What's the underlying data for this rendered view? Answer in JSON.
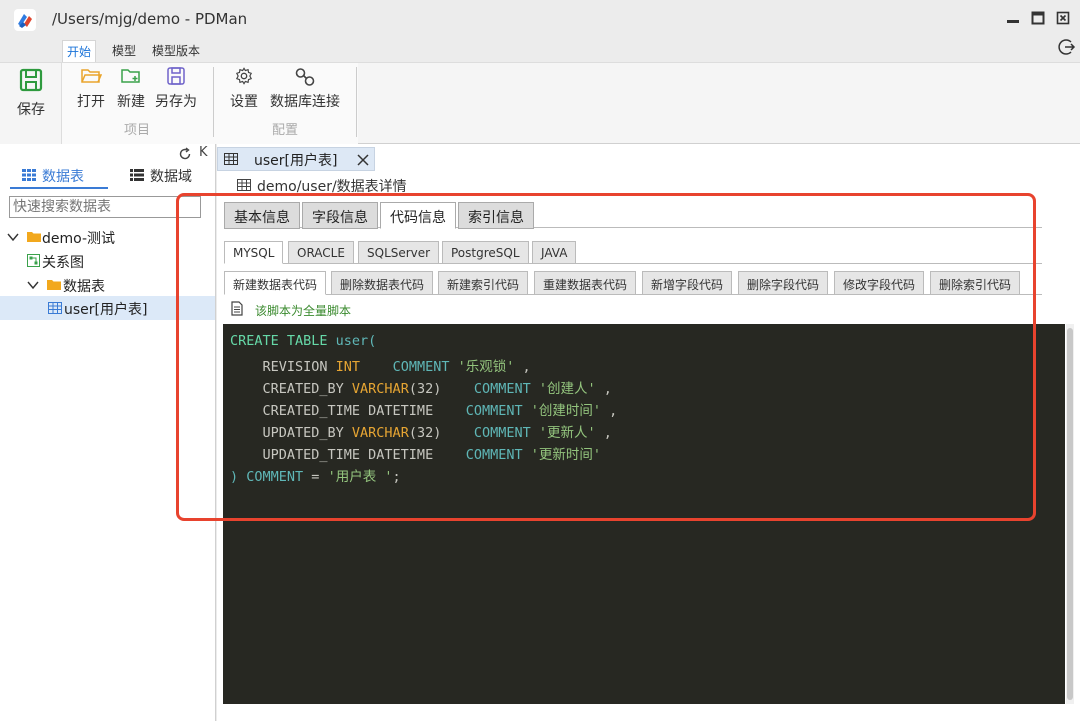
{
  "window": {
    "title": "/Users/mjg/demo - PDMan"
  },
  "ribbon": {
    "tabs": [
      {
        "label": "开始",
        "active": true
      },
      {
        "label": "模型",
        "active": false
      },
      {
        "label": "模型版本",
        "active": false
      }
    ],
    "save_label": "保存",
    "project_group": {
      "label": "项目",
      "buttons": [
        "打开",
        "新建",
        "另存为"
      ]
    },
    "config_group": {
      "label": "配置",
      "buttons": [
        "设置",
        "数据库连接"
      ]
    }
  },
  "sidebar": {
    "tabs": [
      {
        "label": "数据表",
        "active": true
      },
      {
        "label": "数据域",
        "active": false
      }
    ],
    "collapse_label": "K",
    "search_placeholder": "快速搜索数据表",
    "tree": [
      {
        "label": "demo-测试",
        "level": 0
      },
      {
        "label": "关系图",
        "level": 1
      },
      {
        "label": "数据表",
        "level": 1
      },
      {
        "label": "user[用户表]",
        "level": 2,
        "selected": true
      }
    ]
  },
  "main": {
    "doc_tab": "user[用户表]",
    "breadcrumb": "demo/user/数据表详情",
    "info_tabs": [
      {
        "label": "基本信息",
        "active": false
      },
      {
        "label": "字段信息",
        "active": false
      },
      {
        "label": "代码信息",
        "active": true
      },
      {
        "label": "索引信息",
        "active": false
      }
    ],
    "db_tabs": [
      {
        "label": "MYSQL",
        "active": true
      },
      {
        "label": "ORACLE",
        "active": false
      },
      {
        "label": "SQLServer",
        "active": false
      },
      {
        "label": "PostgreSQL",
        "active": false
      },
      {
        "label": "JAVA",
        "active": false
      }
    ],
    "code_tabs": [
      {
        "label": "新建数据表代码",
        "active": true
      },
      {
        "label": "删除数据表代码",
        "active": false
      },
      {
        "label": "新建索引代码",
        "active": false
      },
      {
        "label": "重建数据表代码",
        "active": false
      },
      {
        "label": "新增字段代码",
        "active": false
      },
      {
        "label": "删除字段代码",
        "active": false
      },
      {
        "label": "修改字段代码",
        "active": false
      },
      {
        "label": "删除索引代码",
        "active": false
      }
    ],
    "script_note": "该脚本为全量脚本",
    "code": {
      "l1a": "CREATE TABLE ",
      "l1b": "user(",
      "l2a": "    REVISION ",
      "l2b": "INT",
      "l2c": "    COMMENT ",
      "l2d": "'乐观锁'",
      "l2e": " ,",
      "l3a": "    CREATED_BY ",
      "l3b": "VARCHAR",
      "l3c": "(32)",
      "l3d": "    COMMENT ",
      "l3e": "'创建人'",
      "l3f": " ,",
      "l4a": "    CREATED_TIME DATETIME",
      "l4b": "    COMMENT ",
      "l4c": "'创建时间'",
      "l4d": " ,",
      "l5a": "    UPDATED_BY ",
      "l5b": "VARCHAR",
      "l5c": "(32)",
      "l5d": "    COMMENT ",
      "l5e": "'更新人'",
      "l5f": " ,",
      "l6a": "    UPDATED_TIME DATETIME",
      "l6b": "    COMMENT ",
      "l6c": "'更新时间'",
      "l7a": ") ",
      "l7b": "COMMENT",
      "l7c": " = ",
      "l7d": "'用户表 '",
      "l7e": ";"
    }
  },
  "colors": {
    "accent": "#3a7bd5",
    "highlight": "#e8432e",
    "code_bg": "#272822"
  }
}
